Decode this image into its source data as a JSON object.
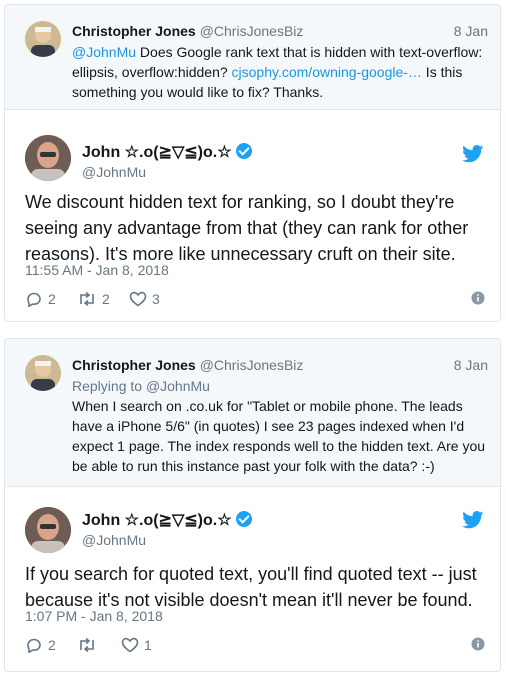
{
  "thread1": {
    "parent": {
      "name": "Christopher Jones",
      "handle": "@ChrisJonesBiz",
      "date": "8 Jan",
      "text_mention": "@JohnMu",
      "text_part1": " Does Google rank text that is hidden with text-overflow: ellipsis, overflow:hidden? ",
      "text_link": "cjsophy.com/owning-google-…",
      "text_part2": " Is this something you would like to fix? Thanks."
    },
    "main": {
      "name": "John ☆.o(≧▽≦)o.☆",
      "handle": "@JohnMu",
      "text": "We discount hidden text for ranking, so I doubt they're seeing any advantage from that (they can rank for other reasons). It's more like unnecessary cruft on their site.",
      "timestamp": "11:55 AM - Jan 8, 2018",
      "replies": "2",
      "retweets": "2",
      "likes": "3"
    }
  },
  "thread2": {
    "parent": {
      "name": "Christopher Jones",
      "handle": "@ChrisJonesBiz",
      "date": "8 Jan",
      "replying_label": "Replying to ",
      "replying_handle": "@JohnMu",
      "text": "When I search on .co.uk for \"Tablet or mobile phone. The leads have a iPhone 5/6\" (in quotes) I see 23 pages indexed when I'd expect 1 page. The index responds well to the hidden text. Are you be able to run this instance past your folk with the data? :-)"
    },
    "main": {
      "name": "John ☆.o(≧▽≦)o.☆",
      "handle": "@JohnMu",
      "text": "If you search for quoted text, you'll find quoted text -- just because it's not visible doesn't mean it'll never be found.",
      "timestamp": "1:07 PM - Jan 8, 2018",
      "replies": "2",
      "retweets": "",
      "likes": "1"
    }
  },
  "colors": {
    "twitter_blue": "#1da1f2",
    "link": "#1b95e0",
    "muted": "#657786",
    "text": "#14171a"
  },
  "icons": [
    "reply-icon",
    "retweet-icon",
    "like-icon",
    "info-icon",
    "twitter-bird-icon",
    "verified-badge-icon"
  ]
}
